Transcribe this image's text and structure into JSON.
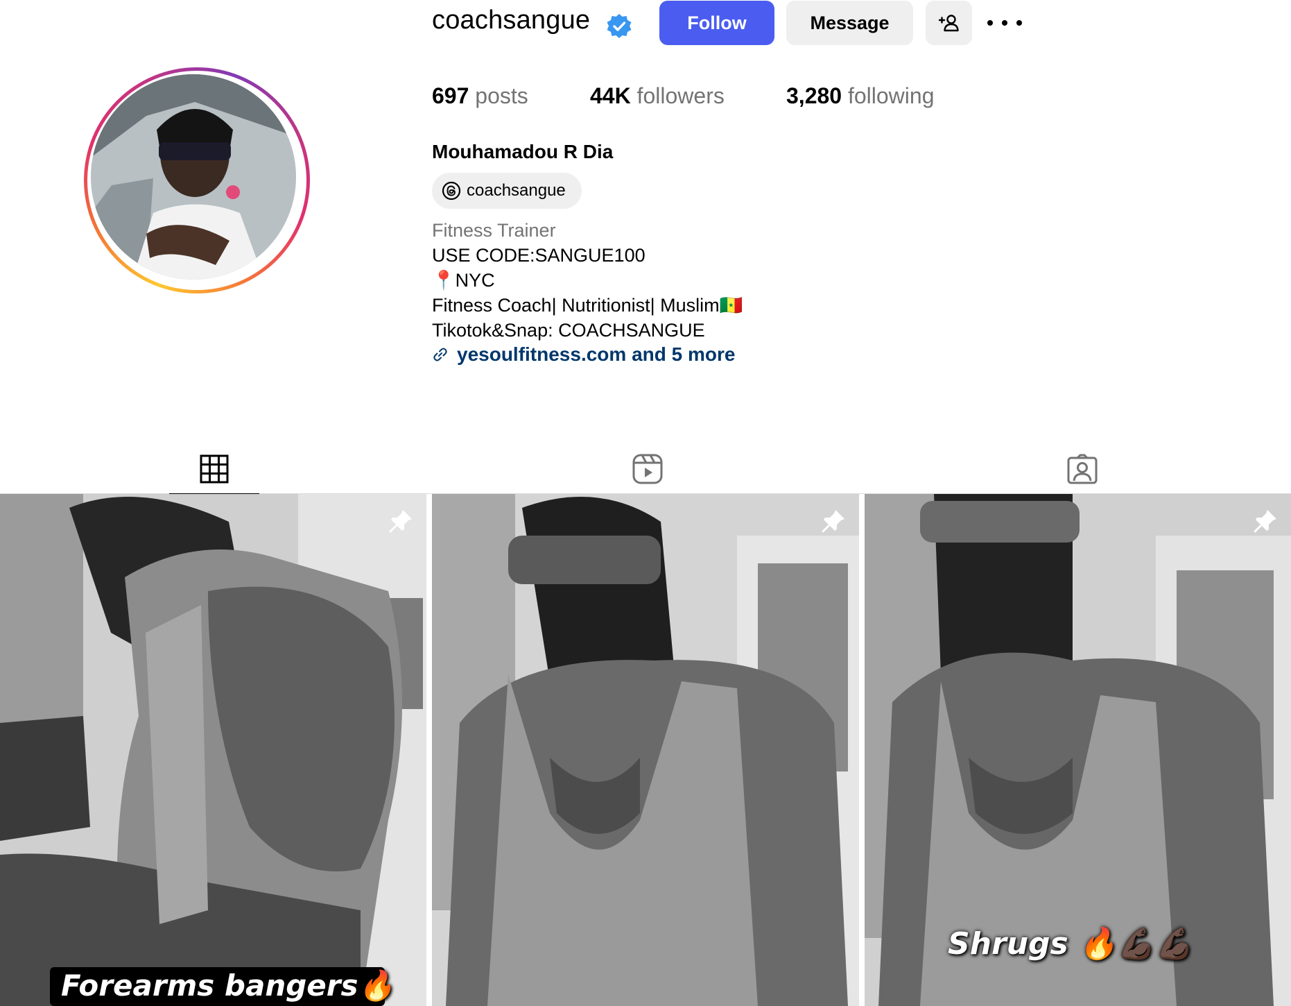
{
  "profile": {
    "username": "coachsangue",
    "verified": true,
    "follow_label": "Follow",
    "message_label": "Message",
    "stats": {
      "posts_count": "697",
      "posts_label": "posts",
      "followers_count": "44K",
      "followers_label": "followers",
      "following_count": "3,280",
      "following_label": "following"
    },
    "full_name": "Mouhamadou R Dia",
    "threads_handle": "coachsangue",
    "category": "Fitness Trainer",
    "bio_lines": [
      "USE CODE:SANGUE100",
      "📍NYC",
      "Fitness Coach| Nutritionist| Muslim🇸🇳",
      "Tikotok&Snap: COACHSANGUE"
    ],
    "link_text": "yesoulfitness.com and 5 more"
  },
  "tabs": [
    {
      "icon": "grid-icon",
      "active": true
    },
    {
      "icon": "reels-icon",
      "active": false
    },
    {
      "icon": "tagged-icon",
      "active": false
    }
  ],
  "posts": [
    {
      "caption": "Forearms bangers🔥",
      "pinned": true
    },
    {
      "caption": "",
      "pinned": true
    },
    {
      "caption": "Shrugs 🔥💪🏿💪🏿",
      "pinned": true
    }
  ],
  "colors": {
    "follow_button": "#4a5df0",
    "secondary_button": "#efefef",
    "verified_badge": "#3897f0",
    "link": "#00376b",
    "muted_text": "#737373"
  }
}
